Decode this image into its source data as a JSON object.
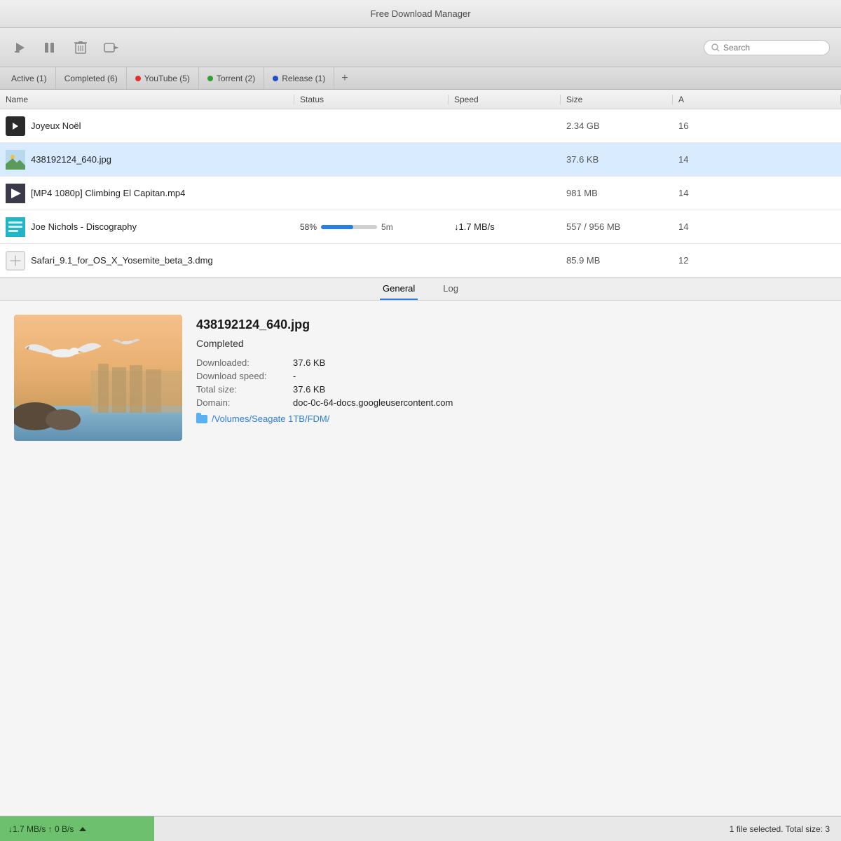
{
  "titlebar": {
    "title": "Free Download Manager"
  },
  "toolbar": {
    "search_placeholder": "Search"
  },
  "tabs": [
    {
      "id": "active",
      "label": "Active (1)",
      "dot_color": null
    },
    {
      "id": "completed",
      "label": "Completed (6)",
      "dot_color": null
    },
    {
      "id": "youtube",
      "label": "YouTube (5)",
      "dot_color": "#e03030"
    },
    {
      "id": "torrent",
      "label": "Torrent (2)",
      "dot_color": "#30a030"
    },
    {
      "id": "release",
      "label": "Release (1)",
      "dot_color": "#2050c8"
    }
  ],
  "table": {
    "headers": {
      "name": "Name",
      "status": "Status",
      "speed": "Speed",
      "size": "Size",
      "added": "A"
    },
    "rows": [
      {
        "id": "row-1",
        "icon_type": "dark",
        "name": "Joyeux Noël",
        "status": "",
        "speed": "",
        "size": "2.34 GB",
        "added": "16"
      },
      {
        "id": "row-2",
        "icon_type": "img",
        "name": "438192124_640.jpg",
        "status": "",
        "speed": "",
        "size": "37.6 KB",
        "added": "14",
        "selected": true
      },
      {
        "id": "row-3",
        "icon_type": "video",
        "name": "[MP4 1080p] Climbing El Capitan.mp4",
        "status": "",
        "speed": "",
        "size": "981 MB",
        "added": "14"
      },
      {
        "id": "row-4",
        "icon_type": "cyan",
        "name": "Joe Nichols - Discography",
        "status_pct": "58%",
        "status_time": "5m",
        "speed": "↓1.7 MB/s",
        "size": "557 / 956 MB",
        "added": "14",
        "progress": 58
      },
      {
        "id": "row-5",
        "icon_type": "white",
        "name": "Safari_9.1_for_OS_X_Yosemite_beta_3.dmg",
        "status": "",
        "speed": "",
        "size": "85.9 MB",
        "added": "12"
      }
    ]
  },
  "detail": {
    "tabs": [
      "General",
      "Log"
    ],
    "active_tab": "General",
    "filename": "438192124_640.jpg",
    "status": "Completed",
    "downloaded_label": "Downloaded:",
    "downloaded_value": "37.6 KB",
    "speed_label": "Download speed:",
    "speed_value": "-",
    "size_label": "Total size:",
    "size_value": "37.6 KB",
    "domain_label": "Domain:",
    "domain_value": "doc-0c-64-docs.googleusercontent.com",
    "path_label": "",
    "path_value": "/Volumes/Seagate 1TB/FDM/"
  },
  "statusbar": {
    "download_speed": "↓1.7 MB/s",
    "upload_speed": "↑ 0 B/s",
    "selection_info": "1 file selected. Total size: 3"
  }
}
